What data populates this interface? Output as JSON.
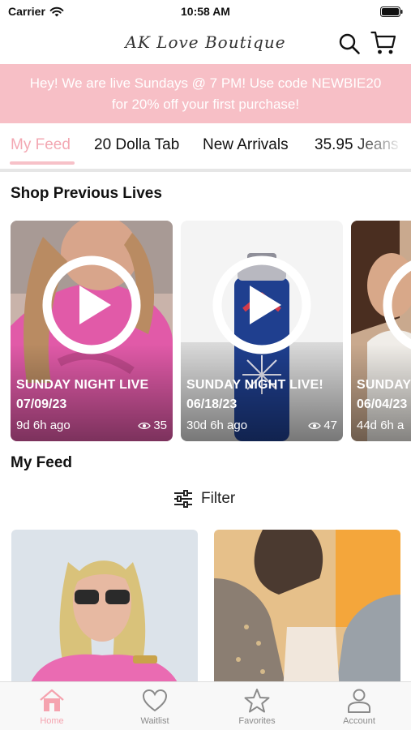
{
  "status_bar": {
    "carrier": "Carrier",
    "time": "10:58 AM"
  },
  "header": {
    "brand": "AK Love Boutique"
  },
  "banner": {
    "line1": "Hey! We are live Sundays @ 7 PM! Use code NEWBIE20",
    "line2": "for 20% off your first purchase!",
    "background": "#f7bfc6"
  },
  "tabs": [
    {
      "label": "My Feed",
      "active": true
    },
    {
      "label": "20 Dolla Tab"
    },
    {
      "label": "New Arrivals"
    },
    {
      "label": "35.95 Jeans"
    }
  ],
  "previous_lives": {
    "title": "Shop Previous Lives",
    "items": [
      {
        "title": "SUNDAY NIGHT LIVE",
        "date": "07/09/23",
        "ago": "9d 6h ago",
        "views": "35"
      },
      {
        "title": "SUNDAY NIGHT LIVE!",
        "date": "06/18/23",
        "ago": "30d 6h ago",
        "views": "47"
      },
      {
        "title": "SUNDAY",
        "date": "06/04/23",
        "ago": "44d 6h a"
      }
    ]
  },
  "feed": {
    "title": "My Feed",
    "filter_label": "Filter"
  },
  "bottom_nav": [
    {
      "label": "Home",
      "icon": "home-icon",
      "active": true
    },
    {
      "label": "Waitlist",
      "icon": "heart-icon"
    },
    {
      "label": "Favorites",
      "icon": "star-icon"
    },
    {
      "label": "Account",
      "icon": "user-icon"
    }
  ],
  "colors": {
    "accent": "#f3a8b3",
    "banner": "#f7bfc6",
    "nav_active": "#f5a3af"
  }
}
